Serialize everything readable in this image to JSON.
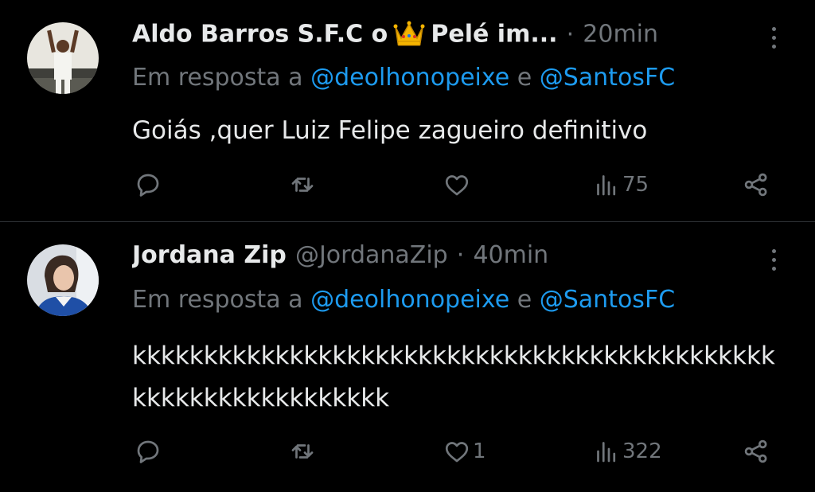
{
  "tweets": [
    {
      "name_before": "Aldo Barros S.F.C o",
      "name_after": "Pelé im...",
      "handle": "",
      "separator": "·",
      "time": "20min",
      "reply_prefix": "Em resposta a",
      "mention1": "@deolhonopeixe",
      "reply_and": "e",
      "mention2": "@SantosFC",
      "text": "Goiás ,quer Luiz Felipe zagueiro definitivo",
      "likes": "",
      "views": "75"
    },
    {
      "name": "Jordana Zip",
      "handle": "@JordanaZip",
      "separator": "·",
      "time": "40min",
      "reply_prefix": "Em resposta a",
      "mention1": "@deolhonopeixe",
      "reply_and": "e",
      "mention2": "@SantosFC",
      "text": "kkkkkkkkkkkkkkkkkkkkkkkkkkkkkkkkkkkkkkkkkkkkkkkkkkkkkkkkkkkkkkk",
      "likes": "1",
      "views": "322"
    }
  ],
  "colors": {
    "background": "#000000",
    "text": "#e7e9ea",
    "muted": "#71767b",
    "link": "#1d9bf0",
    "divider": "#2f3336"
  },
  "icons": [
    "reply-icon",
    "retweet-icon",
    "like-icon",
    "views-icon",
    "share-icon",
    "more-icon",
    "crown-emoji"
  ]
}
